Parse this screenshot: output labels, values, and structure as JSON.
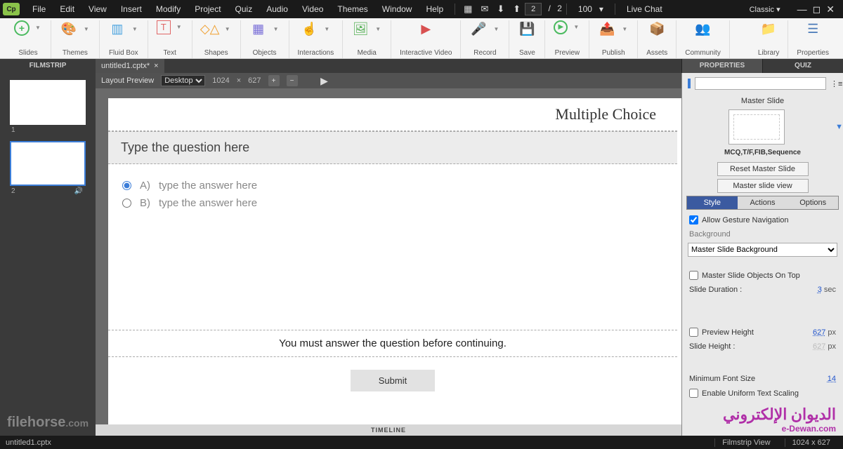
{
  "menu": {
    "items": [
      "File",
      "Edit",
      "View",
      "Insert",
      "Modify",
      "Project",
      "Quiz",
      "Audio",
      "Video",
      "Themes",
      "Window",
      "Help"
    ]
  },
  "topbar": {
    "page_current": "2",
    "page_sep": "/",
    "page_total": "2",
    "zoom": "100",
    "livechat": "Live Chat",
    "workspace": "Classic"
  },
  "ribbon": {
    "groups": [
      "Slides",
      "Themes",
      "Fluid Box",
      "Text",
      "Shapes",
      "Objects",
      "Interactions",
      "Media",
      "Interactive Video",
      "Record",
      "Save",
      "Preview",
      "Publish",
      "Assets",
      "Community"
    ],
    "right": [
      "Library",
      "Properties"
    ]
  },
  "tabs": {
    "filmstrip": "FILMSTRIP",
    "doc": "untitled1.cptx*",
    "properties": "PROPERTIES",
    "quiz": "QUIZ"
  },
  "canvasbar": {
    "layout": "Layout Preview",
    "device": "Desktop",
    "w": "1024",
    "h": "627"
  },
  "slide": {
    "title": "Multiple Choice",
    "question": "Type the question here",
    "answers": [
      {
        "letter": "A)",
        "text": "type the answer here",
        "checked": true
      },
      {
        "letter": "B)",
        "text": "type the answer here",
        "checked": false
      }
    ],
    "feedback": "You must answer the question before continuing.",
    "submit": "Submit"
  },
  "timeline": "TIMELINE",
  "props": {
    "masterslide_label": "Master Slide",
    "master_name": "MCQ,T/F,FIB,Sequence",
    "reset_btn": "Reset Master Slide",
    "view_btn": "Master slide view",
    "subtabs": [
      "Style",
      "Actions",
      "Options"
    ],
    "allow_gesture": "Allow Gesture Navigation",
    "background_label": "Background",
    "background_value": "Master Slide Background",
    "objects_on_top": "Master Slide Objects On Top",
    "duration_label": "Slide Duration :",
    "duration_val": "3",
    "duration_unit": "sec",
    "preview_h_label": "Preview Height",
    "preview_h_val": "627",
    "px": "px",
    "slide_h_label": "Slide Height :",
    "slide_h_val": "627",
    "min_font_label": "Minimum Font Size",
    "min_font_val": "14",
    "scaling": "Enable Uniform Text Scaling"
  },
  "status": {
    "file": "untitled1.cptx",
    "view": "Filmstrip View",
    "dims": "1024 x 627"
  },
  "thumbs": [
    "1",
    "2"
  ]
}
